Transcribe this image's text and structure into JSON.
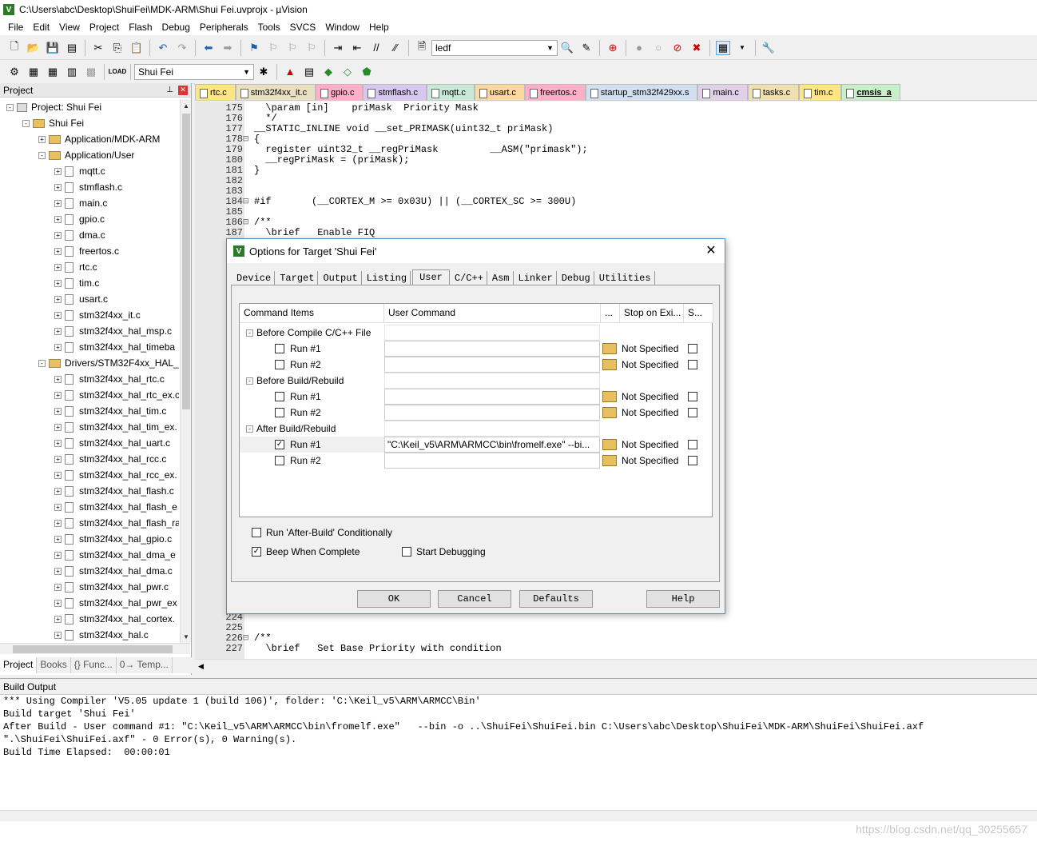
{
  "window": {
    "title": "C:\\Users\\abc\\Desktop\\ShuiFei\\MDK-ARM\\Shui Fei.uvprojx - µVision"
  },
  "menu": [
    "File",
    "Edit",
    "View",
    "Project",
    "Flash",
    "Debug",
    "Peripherals",
    "Tools",
    "SVCS",
    "Window",
    "Help"
  ],
  "toolbar": {
    "find_value": "ledf",
    "target_select": "Shui Fei"
  },
  "project": {
    "header": "Project",
    "tree": [
      {
        "label": "Project: Shui Fei",
        "level": 0,
        "kind": "root",
        "exp": "-"
      },
      {
        "label": "Shui Fei",
        "level": 1,
        "kind": "target",
        "exp": "-"
      },
      {
        "label": "Application/MDK-ARM",
        "level": 2,
        "kind": "folder",
        "exp": "+"
      },
      {
        "label": "Application/User",
        "level": 2,
        "kind": "folder",
        "exp": "-"
      },
      {
        "label": "mqtt.c",
        "level": 3,
        "kind": "file",
        "exp": "+"
      },
      {
        "label": "stmflash.c",
        "level": 3,
        "kind": "file",
        "exp": "+"
      },
      {
        "label": "main.c",
        "level": 3,
        "kind": "file",
        "exp": "+"
      },
      {
        "label": "gpio.c",
        "level": 3,
        "kind": "file",
        "exp": "+"
      },
      {
        "label": "dma.c",
        "level": 3,
        "kind": "file",
        "exp": "+"
      },
      {
        "label": "freertos.c",
        "level": 3,
        "kind": "file",
        "exp": "+"
      },
      {
        "label": "rtc.c",
        "level": 3,
        "kind": "file",
        "exp": "+"
      },
      {
        "label": "tim.c",
        "level": 3,
        "kind": "file",
        "exp": "+"
      },
      {
        "label": "usart.c",
        "level": 3,
        "kind": "file",
        "exp": "+"
      },
      {
        "label": "stm32f4xx_it.c",
        "level": 3,
        "kind": "file",
        "exp": "+"
      },
      {
        "label": "stm32f4xx_hal_msp.c",
        "level": 3,
        "kind": "file",
        "exp": "+"
      },
      {
        "label": "stm32f4xx_hal_timeba",
        "level": 3,
        "kind": "file",
        "exp": "+"
      },
      {
        "label": "Drivers/STM32F4xx_HAL_I",
        "level": 2,
        "kind": "folder",
        "exp": "-"
      },
      {
        "label": "stm32f4xx_hal_rtc.c",
        "level": 3,
        "kind": "file",
        "exp": "+"
      },
      {
        "label": "stm32f4xx_hal_rtc_ex.c",
        "level": 3,
        "kind": "file",
        "exp": "+"
      },
      {
        "label": "stm32f4xx_hal_tim.c",
        "level": 3,
        "kind": "file",
        "exp": "+"
      },
      {
        "label": "stm32f4xx_hal_tim_ex.",
        "level": 3,
        "kind": "file",
        "exp": "+"
      },
      {
        "label": "stm32f4xx_hal_uart.c",
        "level": 3,
        "kind": "file",
        "exp": "+"
      },
      {
        "label": "stm32f4xx_hal_rcc.c",
        "level": 3,
        "kind": "file",
        "exp": "+"
      },
      {
        "label": "stm32f4xx_hal_rcc_ex.",
        "level": 3,
        "kind": "file",
        "exp": "+"
      },
      {
        "label": "stm32f4xx_hal_flash.c",
        "level": 3,
        "kind": "file",
        "exp": "+"
      },
      {
        "label": "stm32f4xx_hal_flash_e",
        "level": 3,
        "kind": "file",
        "exp": "+"
      },
      {
        "label": "stm32f4xx_hal_flash_ra",
        "level": 3,
        "kind": "file",
        "exp": "+"
      },
      {
        "label": "stm32f4xx_hal_gpio.c",
        "level": 3,
        "kind": "file",
        "exp": "+"
      },
      {
        "label": "stm32f4xx_hal_dma_e",
        "level": 3,
        "kind": "file",
        "exp": "+"
      },
      {
        "label": "stm32f4xx_hal_dma.c",
        "level": 3,
        "kind": "file",
        "exp": "+"
      },
      {
        "label": "stm32f4xx_hal_pwr.c",
        "level": 3,
        "kind": "file",
        "exp": "+"
      },
      {
        "label": "stm32f4xx_hal_pwr_ex",
        "level": 3,
        "kind": "file",
        "exp": "+"
      },
      {
        "label": "stm32f4xx_hal_cortex.",
        "level": 3,
        "kind": "file",
        "exp": "+"
      },
      {
        "label": "stm32f4xx_hal.c",
        "level": 3,
        "kind": "file",
        "exp": "+"
      }
    ],
    "bottom_tabs": [
      "Project",
      "Books",
      "{} Func...",
      "0→ Temp..."
    ]
  },
  "editor": {
    "tabs": [
      {
        "label": "rtc.c",
        "color": "#ffe680"
      },
      {
        "label": "stm32f4xx_it.c",
        "color": "#e8e0c0"
      },
      {
        "label": "gpio.c",
        "color": "#ffb0c8"
      },
      {
        "label": "stmflash.c",
        "color": "#d8c8f0"
      },
      {
        "label": "mqtt.c",
        "color": "#c8e8d8"
      },
      {
        "label": "usart.c",
        "color": "#ffd8a0"
      },
      {
        "label": "freertos.c",
        "color": "#ffb0c8"
      },
      {
        "label": "startup_stm32f429xx.s",
        "color": "#d0e0f0"
      },
      {
        "label": "main.c",
        "color": "#e0d0e8"
      },
      {
        "label": "tasks.c",
        "color": "#f0e0b0"
      },
      {
        "label": "tim.c",
        "color": "#ffe680"
      },
      {
        "label": "cmsis_a",
        "color": "#c8f0c8"
      }
    ],
    "lines": [
      {
        "n": "175",
        "f": "",
        "t": "  \\param [in]    priMask  Priority Mask",
        "cls": "cm"
      },
      {
        "n": "176",
        "f": "",
        "t": "  */",
        "cls": "cm"
      },
      {
        "n": "177",
        "f": "",
        "t": "__STATIC_INLINE void __set_PRIMASK(uint32_t priMask)",
        "cls": ""
      },
      {
        "n": "178",
        "f": "⊟",
        "t": "{",
        "cls": ""
      },
      {
        "n": "179",
        "f": "",
        "t": "  register uint32_t __regPriMask         __ASM(\"primask\");",
        "cls": ""
      },
      {
        "n": "180",
        "f": "",
        "t": "  __regPriMask = (priMask);",
        "cls": ""
      },
      {
        "n": "181",
        "f": "",
        "t": "}",
        "cls": ""
      },
      {
        "n": "182",
        "f": "",
        "t": "",
        "cls": ""
      },
      {
        "n": "183",
        "f": "",
        "t": "",
        "cls": ""
      },
      {
        "n": "184",
        "f": "⊟",
        "t": "#if       (__CORTEX_M >= 0x03U) || (__CORTEX_SC >= 300U)",
        "cls": ""
      },
      {
        "n": "185",
        "f": "",
        "t": "",
        "cls": ""
      },
      {
        "n": "186",
        "f": "⊟",
        "t": "/**",
        "cls": "cm"
      },
      {
        "n": "187",
        "f": "",
        "t": "  \\brief   Enable FIQ",
        "cls": "cm"
      },
      {
        "n": "224",
        "f": "",
        "t": "",
        "cls": ""
      },
      {
        "n": "225",
        "f": "",
        "t": "",
        "cls": ""
      },
      {
        "n": "226",
        "f": "⊟",
        "t": "/**",
        "cls": "cm"
      },
      {
        "n": "227",
        "f": "",
        "t": "  \\brief   Set Base Priority with condition",
        "cls": "cm"
      }
    ]
  },
  "build_output": {
    "header": "Build Output",
    "lines": [
      "*** Using Compiler 'V5.05 update 1 (build 106)', folder: 'C:\\Keil_v5\\ARM\\ARMCC\\Bin'",
      "Build target 'Shui Fei'",
      "After Build - User command #1: \"C:\\Keil_v5\\ARM\\ARMCC\\bin\\fromelf.exe\"   --bin -o ..\\ShuiFei\\ShuiFei.bin C:\\Users\\abc\\Desktop\\ShuiFei\\MDK-ARM\\ShuiFei\\ShuiFei.axf",
      "\".\\ShuiFei\\ShuiFei.axf\" - 0 Error(s), 0 Warning(s).",
      "Build Time Elapsed:  00:00:01"
    ],
    "watermark": "https://blog.csdn.net/qq_30255657"
  },
  "dialog": {
    "title": "Options for Target 'Shui Fei'",
    "tabs": [
      "Device",
      "Target",
      "Output",
      "Listing",
      "User",
      "C/C++",
      "Asm",
      "Linker",
      "Debug",
      "Utilities"
    ],
    "active_tab": "User",
    "columns": [
      "Command Items",
      "User Command",
      "...",
      "Stop on Exi...",
      "S..."
    ],
    "rows": [
      {
        "kind": "group",
        "label": "Before Compile C/C++ File"
      },
      {
        "kind": "item",
        "label": "Run #1",
        "checked": false,
        "command": "",
        "stop": "Not Specified"
      },
      {
        "kind": "item",
        "label": "Run #2",
        "checked": false,
        "command": "",
        "stop": "Not Specified"
      },
      {
        "kind": "group",
        "label": "Before Build/Rebuild"
      },
      {
        "kind": "item",
        "label": "Run #1",
        "checked": false,
        "command": "",
        "stop": "Not Specified"
      },
      {
        "kind": "item",
        "label": "Run #2",
        "checked": false,
        "command": "",
        "stop": "Not Specified"
      },
      {
        "kind": "group",
        "label": "After Build/Rebuild"
      },
      {
        "kind": "item",
        "label": "Run #1",
        "checked": true,
        "command": "\"C:\\Keil_v5\\ARM\\ARMCC\\bin\\fromelf.exe\"  --bi...",
        "stop": "Not Specified"
      },
      {
        "kind": "item",
        "label": "Run #2",
        "checked": false,
        "command": "",
        "stop": "Not Specified"
      }
    ],
    "options": {
      "run_after_build": {
        "label": "Run 'After-Build' Conditionally",
        "checked": false
      },
      "beep": {
        "label": "Beep When Complete",
        "checked": true
      },
      "start_debug": {
        "label": "Start Debugging",
        "checked": false
      }
    },
    "buttons": {
      "ok": "OK",
      "cancel": "Cancel",
      "defaults": "Defaults",
      "help": "Help"
    }
  }
}
